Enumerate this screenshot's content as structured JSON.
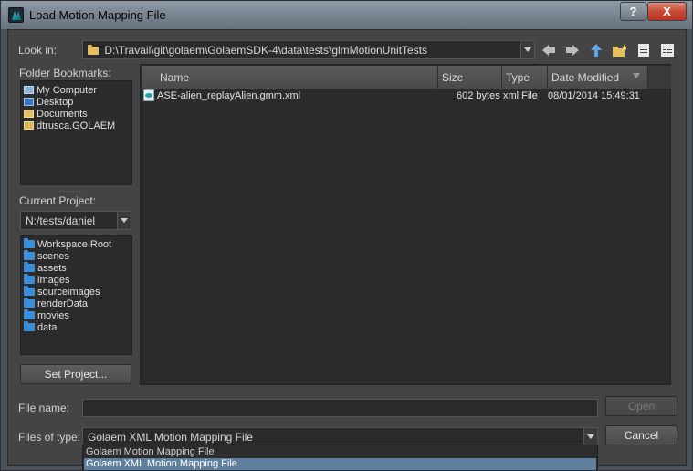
{
  "window": {
    "title": "Load Motion Mapping File",
    "help_label": "?",
    "close_label": "X"
  },
  "look_in": {
    "label": "Look in:",
    "path": "D:\\Travail\\git\\golaem\\GolaemSDK-4\\data\\tests\\glmMotionUnitTests"
  },
  "toolbar_icons": [
    "back-icon",
    "forward-icon",
    "up-folder-icon",
    "new-folder-icon",
    "list-view-icon",
    "detail-view-icon"
  ],
  "bookmarks": {
    "label": "Folder Bookmarks:",
    "items": [
      {
        "label": "My Computer",
        "icon": "computer-icon"
      },
      {
        "label": "Desktop",
        "icon": "desktop-icon"
      },
      {
        "label": "Documents",
        "icon": "documents-icon"
      },
      {
        "label": "dtrusca.GOLAEM",
        "icon": "user-folder-icon"
      }
    ]
  },
  "project": {
    "label": "Current Project:",
    "value": "N:/tests/daniel",
    "folders": [
      "Workspace Root",
      "scenes",
      "assets",
      "images",
      "sourceimages",
      "renderData",
      "movies",
      "data"
    ],
    "set_button": "Set Project..."
  },
  "file_list": {
    "columns": [
      "Name",
      "Size",
      "Type",
      "Date Modified"
    ],
    "rows": [
      {
        "name": "ASE-alien_replayAlien.gmm.xml",
        "size": "602 bytes",
        "type": "xml File",
        "date": "08/01/2014 15:49:31"
      }
    ]
  },
  "file_name": {
    "label": "File name:",
    "value": ""
  },
  "files_of_type": {
    "label": "Files of type:",
    "selected": "Golaem XML Motion Mapping File",
    "options": [
      "Golaem Motion Mapping File",
      "Golaem XML Motion Mapping File"
    ]
  },
  "buttons": {
    "open": "Open",
    "cancel": "Cancel"
  },
  "colors": {
    "accent": "#3c8fd6",
    "selection": "#5f7f9f",
    "background": "#444444"
  }
}
